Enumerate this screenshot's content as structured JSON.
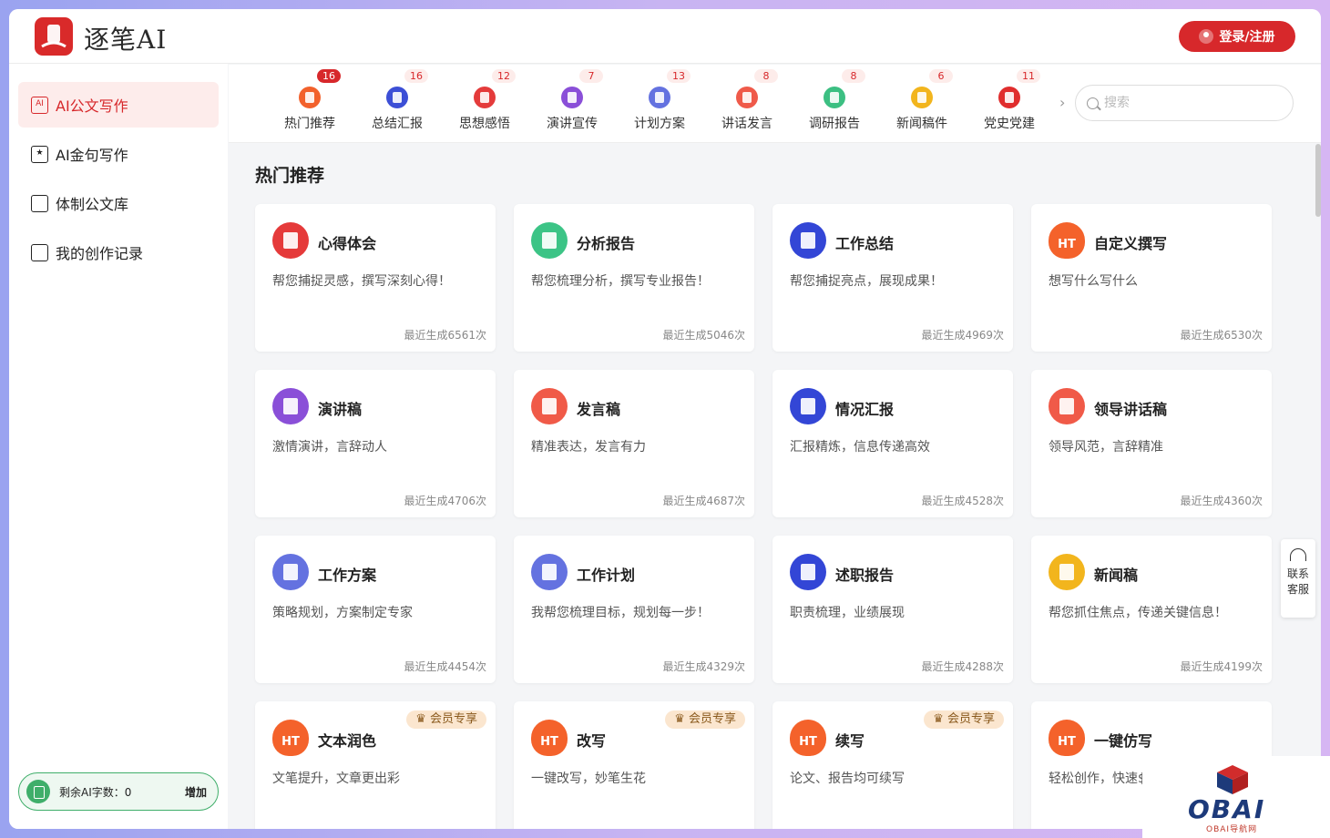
{
  "app": {
    "name": "逐笔AI",
    "login_label": "登录/注册"
  },
  "sidebar": {
    "items": [
      {
        "label": "AI公文写作",
        "active": true
      },
      {
        "label": "AI金句写作",
        "active": false
      },
      {
        "label": "体制公文库",
        "active": false
      },
      {
        "label": "我的创作记录",
        "active": false
      }
    ],
    "quota_label": "剩余AI字数：0",
    "quota_add": "增加"
  },
  "categories": [
    {
      "label": "热门推荐",
      "badge": "16",
      "color": "#f2612c",
      "icon": "fire-icon"
    },
    {
      "label": "总结汇报",
      "badge": "16",
      "color": "#3c4fd6",
      "icon": "pen-doc-icon"
    },
    {
      "label": "思想感悟",
      "badge": "12",
      "color": "#e43b3b",
      "icon": "heart-doc-icon"
    },
    {
      "label": "演讲宣传",
      "badge": "7",
      "color": "#8a4fd8",
      "icon": "presentation-icon"
    },
    {
      "label": "计划方案",
      "badge": "13",
      "color": "#6472e0",
      "icon": "plan-doc-icon"
    },
    {
      "label": "讲话发言",
      "badge": "8",
      "color": "#ef5a4a",
      "icon": "speaker-icon"
    },
    {
      "label": "调研报告",
      "badge": "8",
      "color": "#3cbf82",
      "icon": "report-icon"
    },
    {
      "label": "新闻稿件",
      "badge": "6",
      "color": "#f2b51d",
      "icon": "news-icon"
    },
    {
      "label": "党史党建",
      "badge": "11",
      "color": "#e02d2d",
      "icon": "party-icon"
    }
  ],
  "search": {
    "placeholder": "搜索"
  },
  "section": {
    "title": "热门推荐"
  },
  "cards": [
    {
      "title": "心得体会",
      "desc": "帮您捕捉灵感，撰写深刻心得！",
      "count": "最近生成6561次",
      "color": "#e53a3a",
      "icon": "heart-doc-icon",
      "vip": ""
    },
    {
      "title": "分析报告",
      "desc": "帮您梳理分析，撰写专业报告！",
      "count": "最近生成5046次",
      "color": "#3cc486",
      "icon": "report-icon",
      "vip": ""
    },
    {
      "title": "工作总结",
      "desc": "帮您捕捉亮点，展现成果！",
      "count": "最近生成4969次",
      "color": "#3346d6",
      "icon": "pen-doc-icon",
      "vip": ""
    },
    {
      "title": "自定义撰写",
      "desc": "想写什么写什么",
      "count": "最近生成6530次",
      "color": "#f4622b",
      "icon": "fire-icon",
      "vip": ""
    },
    {
      "title": "演讲稿",
      "desc": "激情演讲，言辞动人",
      "count": "最近生成4706次",
      "color": "#8a4fd8",
      "icon": "presentation-icon",
      "vip": ""
    },
    {
      "title": "发言稿",
      "desc": "精准表达，发言有力",
      "count": "最近生成4687次",
      "color": "#f05a48",
      "icon": "speaker-icon",
      "vip": ""
    },
    {
      "title": "情况汇报",
      "desc": "汇报精炼，信息传递高效",
      "count": "最近生成4528次",
      "color": "#3346d6",
      "icon": "pen-doc-icon",
      "vip": ""
    },
    {
      "title": "领导讲话稿",
      "desc": "领导风范，言辞精准",
      "count": "最近生成4360次",
      "color": "#f05a48",
      "icon": "speaker-icon",
      "vip": ""
    },
    {
      "title": "工作方案",
      "desc": "策略规划，方案制定专家",
      "count": "最近生成4454次",
      "color": "#6472e0",
      "icon": "plan-doc-icon",
      "vip": ""
    },
    {
      "title": "工作计划",
      "desc": "我帮您梳理目标，规划每一步！",
      "count": "最近生成4329次",
      "color": "#6472e0",
      "icon": "plan-doc-icon",
      "vip": ""
    },
    {
      "title": "述职报告",
      "desc": "职责梳理，业绩展现",
      "count": "最近生成4288次",
      "color": "#3346d6",
      "icon": "pen-doc-icon",
      "vip": ""
    },
    {
      "title": "新闻稿",
      "desc": "帮您抓住焦点，传递关键信息！",
      "count": "最近生成4199次",
      "color": "#f2b51d",
      "icon": "news-icon",
      "vip": ""
    },
    {
      "title": "文本润色",
      "desc": "文笔提升，文章更出彩",
      "count": "",
      "color": "#f4622b",
      "icon": "fire-icon",
      "vip": "会员专享"
    },
    {
      "title": "改写",
      "desc": "一键改写，妙笔生花",
      "count": "",
      "color": "#f4622b",
      "icon": "fire-icon",
      "vip": "会员专享"
    },
    {
      "title": "续写",
      "desc": "论文、报告均可续写",
      "count": "",
      "color": "#f4622b",
      "icon": "fire-icon",
      "vip": "会员专享"
    },
    {
      "title": "一键仿写",
      "desc": "轻松创作，快速$",
      "count": "",
      "color": "#f4622b",
      "icon": "fire-icon",
      "vip": ""
    }
  ],
  "service": {
    "line1": "联系",
    "line2": "客服"
  },
  "watermark": {
    "title": "OBAI",
    "subtitle": "OBAI导航网"
  },
  "colors": {
    "brand": "#d7282b",
    "page_bg": "#f4f5f7",
    "quota_green": "#3fae6a",
    "vip_bg": "#fbe6cf"
  }
}
